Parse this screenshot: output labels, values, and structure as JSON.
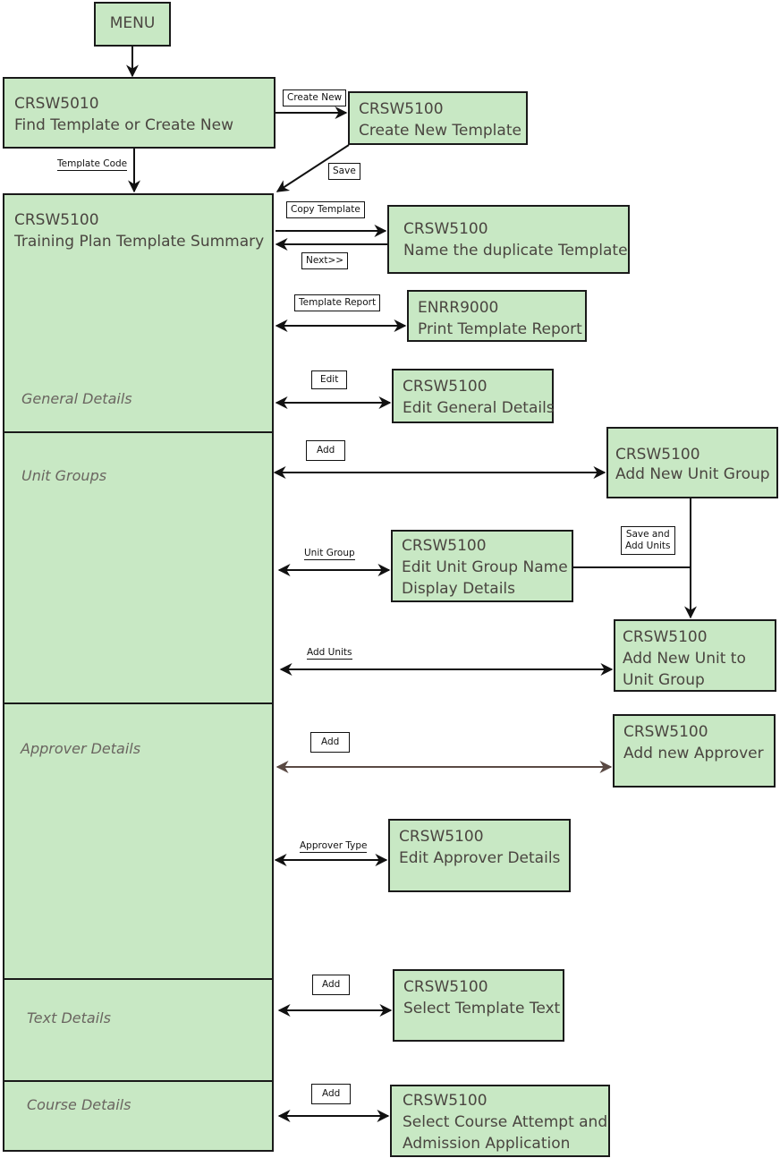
{
  "colors": {
    "box_fill": "#c8e8c4",
    "line": "#111111",
    "approver_arrow": "#5a4a44"
  },
  "menu": "MENU",
  "find": {
    "code": "CRSW5010",
    "title": "Find Template or Create New"
  },
  "create": {
    "code": "CRSW5100",
    "title": "Create New Template"
  },
  "summary": {
    "code": "CRSW5100",
    "title": "Training Plan Template Summary"
  },
  "sections": {
    "general": "General Details",
    "unit_groups": "Unit Groups",
    "approver": "Approver Details",
    "text": "Text Details",
    "course": "Course Details"
  },
  "duplicate": {
    "code": "CRSW5100",
    "title": "Name the duplicate Template"
  },
  "report": {
    "code": "ENRR9000",
    "title": "Print Template Report"
  },
  "edit_general": {
    "code": "CRSW5100",
    "title": "Edit General Details"
  },
  "add_unit_group": {
    "code": "CRSW5100",
    "title": "Add New Unit Group"
  },
  "edit_unit_group": {
    "code": "CRSW5100",
    "line1": "Edit Unit Group Name",
    "line2": "Display Details"
  },
  "add_unit": {
    "code": "CRSW5100",
    "line1": "Add New Unit to",
    "line2": "Unit Group"
  },
  "add_approver": {
    "code": "CRSW5100",
    "title": "Add new Approver"
  },
  "edit_approver": {
    "code": "CRSW5100",
    "title": "Edit Approver Details"
  },
  "select_text": {
    "code": "CRSW5100",
    "title": "Select Template Text"
  },
  "select_course": {
    "code": "CRSW5100",
    "line1": "Select Course Attempt and",
    "line2": "Admission Application"
  },
  "labels": {
    "create_new": "Create New",
    "save": "Save",
    "template_code": "Template Code",
    "copy_template": "Copy Template",
    "next": "Next>>",
    "template_report": "Template Report",
    "edit": "Edit",
    "add_ug": "Add",
    "save_add_1": "Save and",
    "save_add_2": "Add Units",
    "unit_group": "Unit Group",
    "add_units": "Add Units",
    "add_approver": "Add",
    "approver_type": "Approver Type",
    "add_text": "Add",
    "add_course": "Add"
  }
}
